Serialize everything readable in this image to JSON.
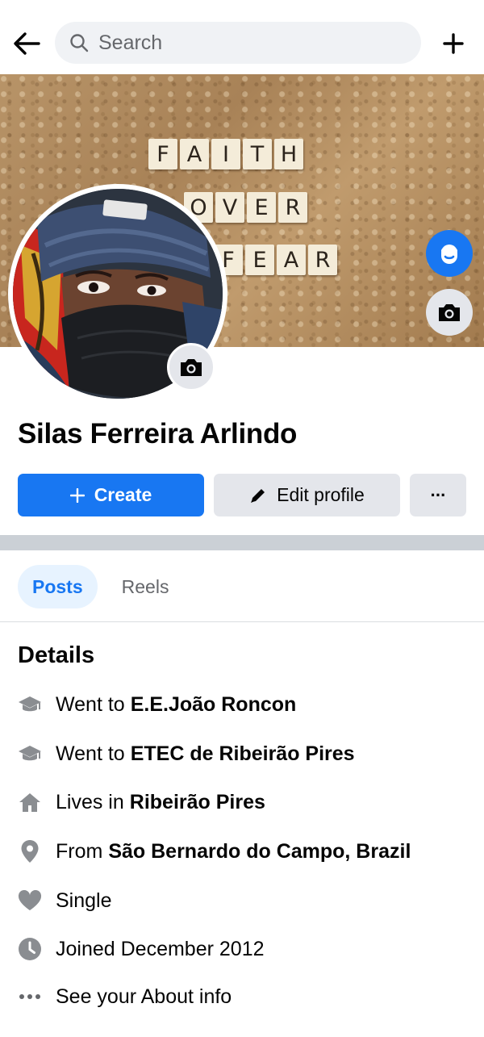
{
  "search": {
    "placeholder": "Search"
  },
  "cover": {
    "tiles": [
      [
        "F",
        "A",
        "I",
        "T",
        "H"
      ],
      [
        "O",
        "V",
        "E",
        "R"
      ],
      [
        "F",
        "E",
        "A",
        "R"
      ]
    ]
  },
  "profile": {
    "name": "Silas Ferreira Arlindo"
  },
  "actions": {
    "create_label": "Create",
    "edit_label": "Edit profile",
    "more_label": "···"
  },
  "tabs": [
    {
      "label": "Posts",
      "active": true
    },
    {
      "label": "Reels",
      "active": false
    }
  ],
  "details": {
    "title": "Details",
    "items": [
      {
        "icon": "graduation-cap-icon",
        "prefix": "Went to",
        "value": "E.E.João Roncon"
      },
      {
        "icon": "graduation-cap-icon",
        "prefix": "Went to",
        "value": "ETEC de Ribeirão Pires"
      },
      {
        "icon": "home-icon",
        "prefix": "Lives in",
        "value": "Ribeirão Pires"
      },
      {
        "icon": "location-pin-icon",
        "prefix": "From",
        "value": "São Bernardo do Campo, Brazil"
      },
      {
        "icon": "heart-icon",
        "prefix": "Single",
        "value": ""
      },
      {
        "icon": "clock-icon",
        "prefix": "Joined December 2012",
        "value": ""
      },
      {
        "icon": "more-dots-icon",
        "prefix": "See your About info",
        "value": ""
      }
    ]
  },
  "colors": {
    "accent": "#1877f2",
    "secondary_bg": "#e4e6eb",
    "icon_gray": "#8a8d91"
  }
}
